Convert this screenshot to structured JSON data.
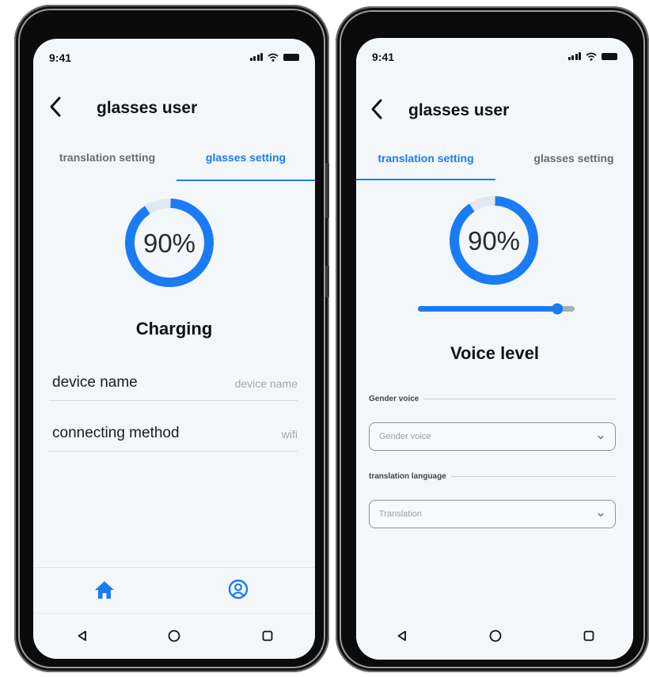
{
  "colors": {
    "accent": "#1a7cf5",
    "text": "#121212",
    "muted": "#a6a6a6"
  },
  "left_phone": {
    "status": {
      "time": "9:41"
    },
    "header": {
      "title": "glasses user"
    },
    "tabs": [
      {
        "label": "translation setting",
        "active": false
      },
      {
        "label": "glasses setting",
        "active": true
      }
    ],
    "battery": {
      "percent_text": "90%",
      "percent": 90
    },
    "state_label": "Charging",
    "fields": [
      {
        "label": "device name",
        "value": "device name"
      },
      {
        "label": "connecting method",
        "value": "wifi"
      }
    ],
    "bottom_nav": {
      "home_icon": "home-icon",
      "profile_icon": "profile-icon"
    }
  },
  "right_phone": {
    "status": {
      "time": "9:41"
    },
    "header": {
      "title": "glasses user"
    },
    "tabs": [
      {
        "label": "translation setting",
        "active": true
      },
      {
        "label": "glasses setting",
        "active": false
      }
    ],
    "volume": {
      "percent_text": "90%",
      "percent": 90,
      "slider_value": 0.89
    },
    "state_label": "Voice level",
    "gender": {
      "section_label": "Gender voice",
      "placeholder": "Gender voice"
    },
    "language": {
      "section_label": "translation language",
      "placeholder": "Translation"
    }
  }
}
